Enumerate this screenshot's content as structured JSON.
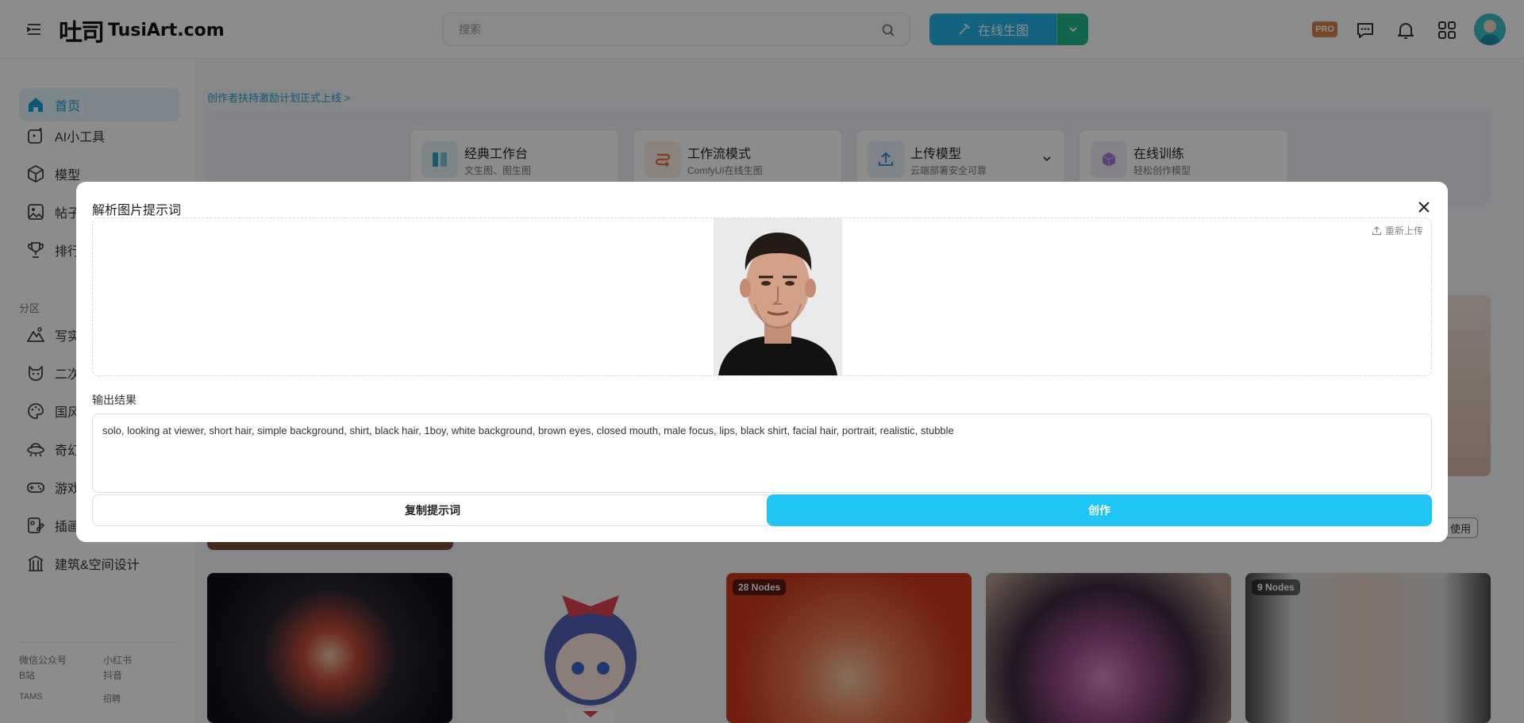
{
  "header": {
    "logo_mark": "吐司",
    "logo_text": "TusiArt.com",
    "search_placeholder": "搜索",
    "generate_label": "在线生图",
    "pro_label": "PRO"
  },
  "sidebar": {
    "items": [
      {
        "label": "首页",
        "icon": "home-icon"
      },
      {
        "label": "AI小工具",
        "icon": "ai-tools-icon"
      },
      {
        "label": "模型",
        "icon": "cube-icon"
      },
      {
        "label": "帖子",
        "icon": "image-icon"
      },
      {
        "label": "排行",
        "icon": "trophy-icon"
      }
    ],
    "section_label": "分区",
    "zones": [
      {
        "label": "写实",
        "icon": "mountain-icon"
      },
      {
        "label": "二次",
        "icon": "cat-icon"
      },
      {
        "label": "国风",
        "icon": "palette-icon"
      },
      {
        "label": "奇幻",
        "icon": "ufo-icon"
      },
      {
        "label": "游戏",
        "icon": "gamepad-icon"
      },
      {
        "label": "插画",
        "icon": "illustration-icon"
      },
      {
        "label": "建筑&空间设计",
        "icon": "building-icon"
      }
    ],
    "footer": {
      "wechat": "微信公众号",
      "xiaohongshu": "小红书",
      "bilibili": "B站",
      "douyin": "抖音",
      "tams": "TAMS",
      "recruit": "招聘"
    }
  },
  "main": {
    "announcement": "创作者扶持激励计划正式上线 >",
    "quick_cards": [
      {
        "title": "经典工作台",
        "subtitle": "文生图、图生图",
        "color": "#e3f3f7",
        "accent": "#2aa6c4"
      },
      {
        "title": "工作流模式",
        "subtitle": "ComfyUI在线生图",
        "color": "#fbeee5",
        "accent": "#e8743c"
      },
      {
        "title": "上传模型",
        "subtitle": "云端部署安全可靠",
        "color": "#e5f1fb",
        "accent": "#3a8fd6"
      },
      {
        "title": "在线训练",
        "subtitle": "轻松创作模型",
        "color": "#f1ebf8",
        "accent": "#a577d4"
      }
    ],
    "use_label": "使用",
    "badges": {
      "card3": "28 Nodes",
      "card5": "9 Nodes"
    }
  },
  "modal": {
    "title": "解析图片提示词",
    "reupload_label": "重新上传",
    "result_label": "输出结果",
    "result_text": "solo, looking at viewer, short hair, simple background, shirt, black hair, 1boy, white background, brown eyes, closed mouth, male focus, lips, black shirt, facial hair, portrait, realistic, stubble",
    "copy_label": "复制提示词",
    "create_label": "创作"
  },
  "colors": {
    "accent": "#1fb4e8",
    "accent_green": "#1fb890",
    "create_button": "#1fc6f5",
    "active_nav_bg": "#e3f5fb"
  }
}
